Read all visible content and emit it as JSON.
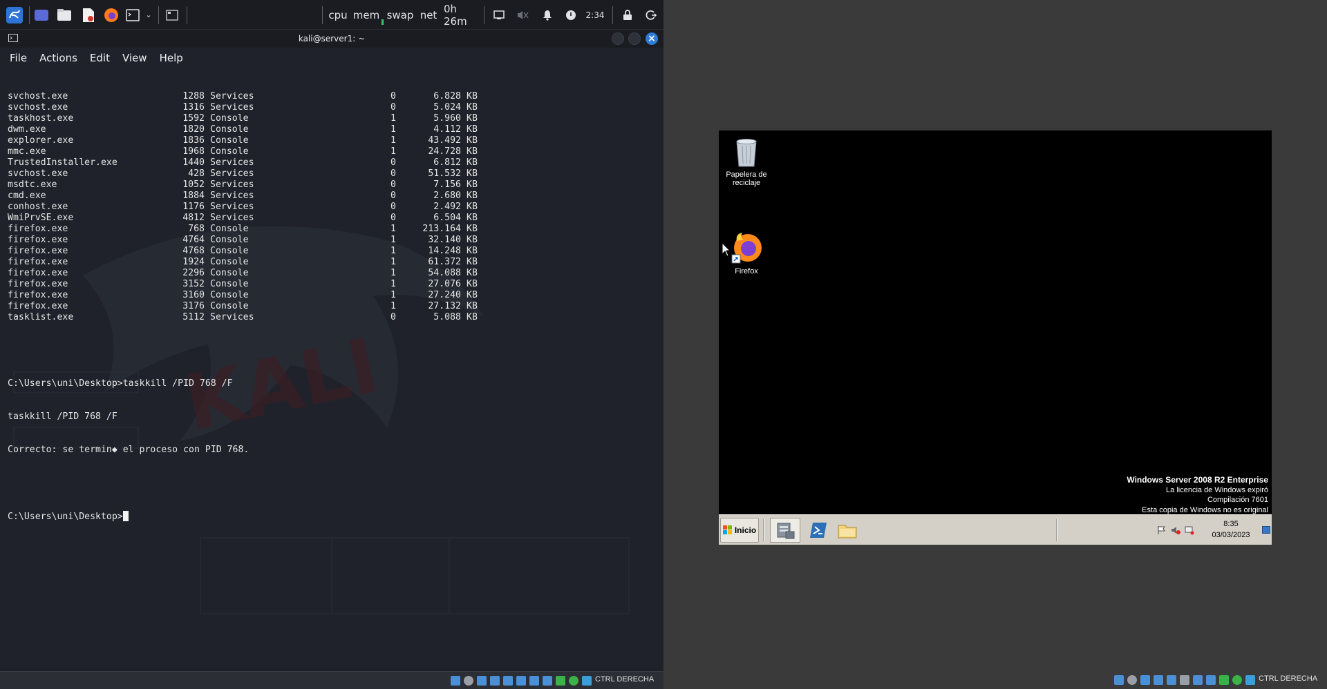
{
  "kali_panel": {
    "indicators": [
      "cpu",
      "mem",
      "swap",
      "net"
    ],
    "uptime": "0h 26m",
    "clock": "2:34",
    "icons": [
      "kali-menu-icon",
      "desktop-icon",
      "files-icon",
      "text-editor-icon",
      "firefox-icon",
      "terminal-icon",
      "chevron-down-icon",
      "workspace-icon",
      "screen-icon",
      "mute-icon",
      "bell-icon",
      "power-icon",
      "lock-icon",
      "logout-icon"
    ]
  },
  "terminal": {
    "title": "kali@server1: ~",
    "menu": [
      "File",
      "Actions",
      "Edit",
      "View",
      "Help"
    ],
    "processes": [
      {
        "name": "svchost.exe",
        "pid": "1288",
        "session": "Services",
        "num": "0",
        "mem": "6.828",
        "unit": "KB"
      },
      {
        "name": "svchost.exe",
        "pid": "1316",
        "session": "Services",
        "num": "0",
        "mem": "5.024",
        "unit": "KB"
      },
      {
        "name": "taskhost.exe",
        "pid": "1592",
        "session": "Console",
        "num": "1",
        "mem": "5.960",
        "unit": "KB"
      },
      {
        "name": "dwm.exe",
        "pid": "1820",
        "session": "Console",
        "num": "1",
        "mem": "4.112",
        "unit": "KB"
      },
      {
        "name": "explorer.exe",
        "pid": "1836",
        "session": "Console",
        "num": "1",
        "mem": "43.492",
        "unit": "KB"
      },
      {
        "name": "mmc.exe",
        "pid": "1968",
        "session": "Console",
        "num": "1",
        "mem": "24.728",
        "unit": "KB"
      },
      {
        "name": "TrustedInstaller.exe",
        "pid": "1440",
        "session": "Services",
        "num": "0",
        "mem": "6.812",
        "unit": "KB"
      },
      {
        "name": "svchost.exe",
        "pid": "428",
        "session": "Services",
        "num": "0",
        "mem": "51.532",
        "unit": "KB"
      },
      {
        "name": "msdtc.exe",
        "pid": "1052",
        "session": "Services",
        "num": "0",
        "mem": "7.156",
        "unit": "KB"
      },
      {
        "name": "cmd.exe",
        "pid": "1884",
        "session": "Services",
        "num": "0",
        "mem": "2.680",
        "unit": "KB"
      },
      {
        "name": "conhost.exe",
        "pid": "1176",
        "session": "Services",
        "num": "0",
        "mem": "2.492",
        "unit": "KB"
      },
      {
        "name": "WmiPrvSE.exe",
        "pid": "4812",
        "session": "Services",
        "num": "0",
        "mem": "6.504",
        "unit": "KB"
      },
      {
        "name": "firefox.exe",
        "pid": "768",
        "session": "Console",
        "num": "1",
        "mem": "213.164",
        "unit": "KB"
      },
      {
        "name": "firefox.exe",
        "pid": "4764",
        "session": "Console",
        "num": "1",
        "mem": "32.140",
        "unit": "KB"
      },
      {
        "name": "firefox.exe",
        "pid": "4768",
        "session": "Console",
        "num": "1",
        "mem": "14.248",
        "unit": "KB"
      },
      {
        "name": "firefox.exe",
        "pid": "1924",
        "session": "Console",
        "num": "1",
        "mem": "61.372",
        "unit": "KB"
      },
      {
        "name": "firefox.exe",
        "pid": "2296",
        "session": "Console",
        "num": "1",
        "mem": "54.088",
        "unit": "KB"
      },
      {
        "name": "firefox.exe",
        "pid": "3152",
        "session": "Console",
        "num": "1",
        "mem": "27.076",
        "unit": "KB"
      },
      {
        "name": "firefox.exe",
        "pid": "3160",
        "session": "Console",
        "num": "1",
        "mem": "27.240",
        "unit": "KB"
      },
      {
        "name": "firefox.exe",
        "pid": "3176",
        "session": "Console",
        "num": "1",
        "mem": "27.132",
        "unit": "KB"
      },
      {
        "name": "tasklist.exe",
        "pid": "5112",
        "session": "Services",
        "num": "0",
        "mem": "5.088",
        "unit": "KB"
      }
    ],
    "command_lines": [
      "C:\\Users\\uni\\Desktop>taskkill /PID 768 /F",
      "taskkill /PID 768 /F",
      "Correcto: se termin◆ el proceso con PID 768."
    ],
    "prompt": "C:\\Users\\uni\\Desktop>"
  },
  "vbox_status": {
    "host_key_label": "CTRL DERECHA"
  },
  "windows_vm": {
    "desktop_icons": [
      {
        "label_line1": "Papelera de",
        "label_line2": "reciclaje"
      },
      {
        "label_line1": "Firefox",
        "label_line2": ""
      }
    ],
    "watermark": {
      "title": "Windows Server 2008 R2 Enterprise",
      "line2": "La licencia de Windows expiró",
      "line3": "Compilación  7601",
      "line4": "Esta copia de Windows no es original"
    },
    "taskbar": {
      "start_label": "Inicio",
      "time": "8:35",
      "date": "03/03/2023"
    }
  }
}
